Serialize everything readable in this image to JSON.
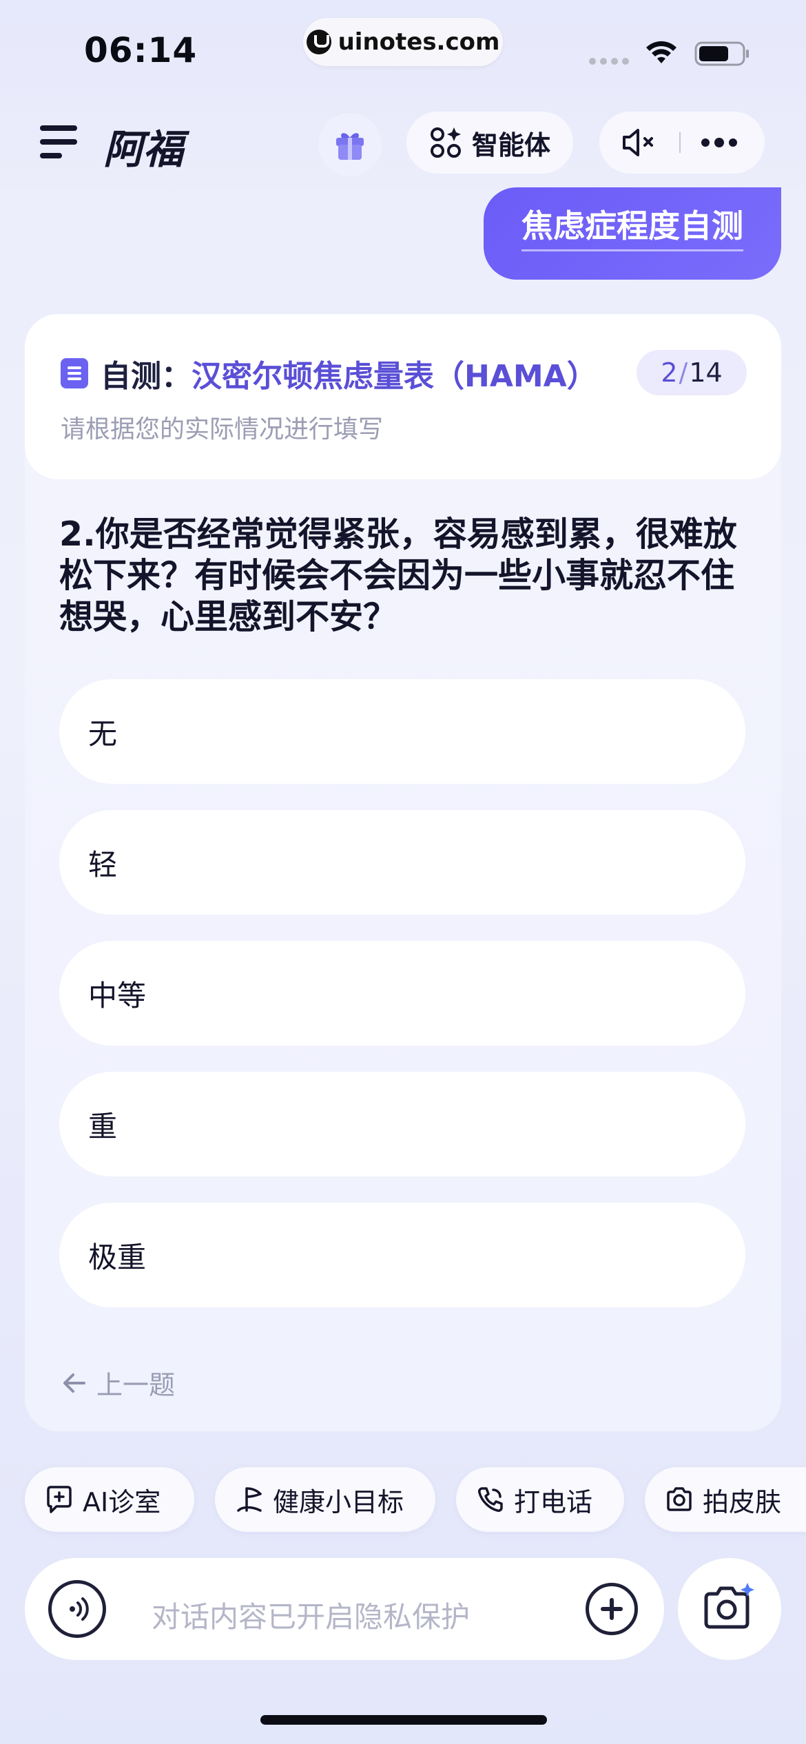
{
  "status_bar": {
    "time": "06:14",
    "url": "uinotes.com"
  },
  "header": {
    "title": "阿福",
    "agent_label": "智能体",
    "icons": [
      "menu-icon",
      "gift-icon",
      "agents-icon",
      "mute-icon",
      "more-icon"
    ]
  },
  "user_message": {
    "text": "焦虑症程度自测"
  },
  "test_card": {
    "title_prefix": "自测：",
    "title_name": "汉密尔顿焦虑量表（HAMA）",
    "progress_current": "2",
    "progress_separator": "/",
    "progress_total": "14",
    "subtitle": "请根据您的实际情况进行填写",
    "question": "2.你是否经常觉得紧张，容易感到累，很难放松下来？有时候会不会因为一些小事就忍不住想哭，心里感到不安？",
    "options": [
      {
        "label": "无"
      },
      {
        "label": "轻"
      },
      {
        "label": "中等"
      },
      {
        "label": "重"
      },
      {
        "label": "极重"
      }
    ],
    "prev_label": "上一题"
  },
  "quick_actions": [
    {
      "label": "AI诊室"
    },
    {
      "label": "健康小目标"
    },
    {
      "label": "打电话"
    },
    {
      "label": "拍皮肤"
    }
  ],
  "input": {
    "placeholder": "对话内容已开启隐私保护"
  },
  "colors": {
    "accent": "#6b5cf7",
    "title_accent": "#5a4fd6",
    "text": "#14142a",
    "muted": "#9b9db3"
  }
}
